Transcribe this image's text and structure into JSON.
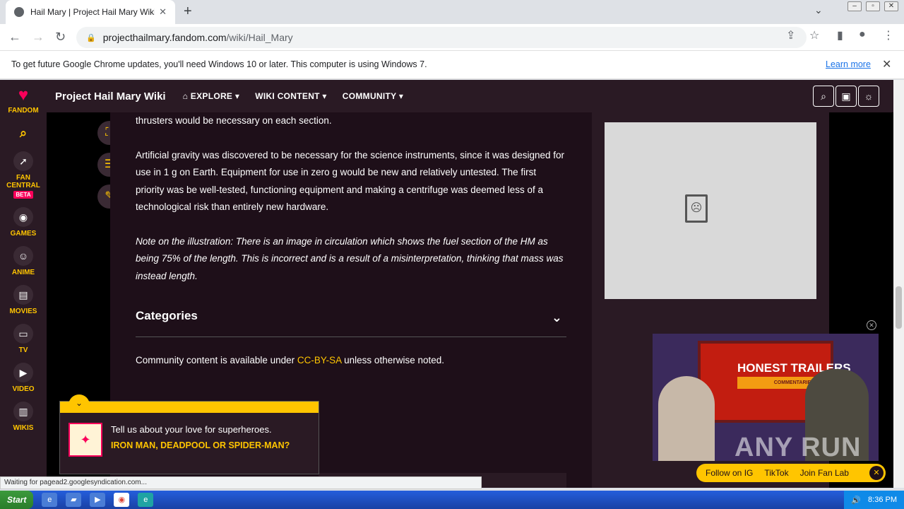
{
  "browser": {
    "tab_title": "Hail Mary | Project Hail Mary Wiki | F",
    "url_host": "projecthailmary.fandom.com",
    "url_path": "/wiki/Hail_Mary"
  },
  "infobar": {
    "message": "To get future Google Chrome updates, you'll need Windows 10 or later. This computer is using Windows 7.",
    "link": "Learn more"
  },
  "rail": {
    "logo": "FANDOM",
    "items": [
      "FAN CENTRAL",
      "GAMES",
      "ANIME",
      "MOVIES",
      "TV",
      "VIDEO",
      "WIKIS"
    ],
    "beta": "BETA"
  },
  "topnav": {
    "title": "Project Hail Mary Wiki",
    "items": [
      "EXPLORE",
      "WIKI CONTENT",
      "COMMUNITY"
    ]
  },
  "article": {
    "p0": "thrusters would be necessary on each section.",
    "p1": "Artificial gravity was discovered to be necessary for the science instruments, since it was designed for use in 1 g on Earth. Equipment for use in zero g would be new and relatively untested. The first priority was be well-tested, functioning equipment and making a centrifuge was deemed less of a technological risk than entirely new hardware.",
    "p2": "Note on the illustration: There is an image in circulation which shows the fuel section of the HM as being 75% of the length. This is incorrect and is a result of a misinterpretation, thinking that mass was instead length.",
    "categories": "Categories",
    "license_pre": "Community content is available under ",
    "license_link": "CC-BY-SA",
    "license_post": " unless otherwise noted."
  },
  "quiz": {
    "line1": "Tell us about your love for superheroes.",
    "line2": "IRON MAN, DEADPOOL OR SPIDER-MAN?"
  },
  "video": {
    "title": "HONEST TRAILERS",
    "subtitle": "COMMENTARIES",
    "watermark": "ANY RUN"
  },
  "social": {
    "items": [
      "Follow on IG",
      "TikTok",
      "Join Fan Lab"
    ]
  },
  "status": "Waiting for pagead2.googlesyndication.com...",
  "taskbar": {
    "start": "Start",
    "time": "8:36 PM"
  }
}
